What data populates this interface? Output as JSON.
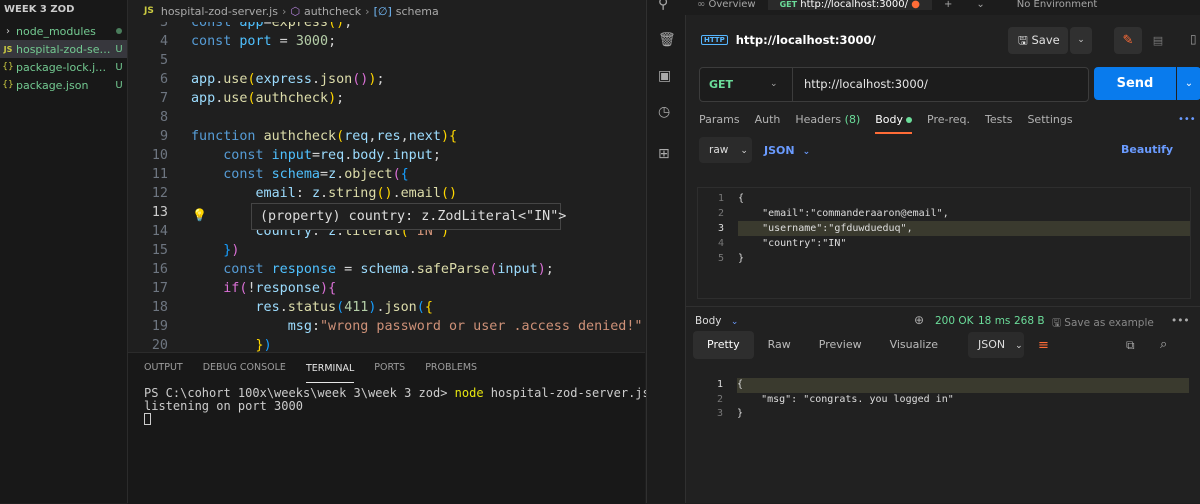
{
  "explorer": {
    "title": "WEEK 3 ZOD",
    "items": [
      {
        "icon": "›",
        "name": "node_modules",
        "badge": ""
      },
      {
        "icon": "JS",
        "name": "hospital-zod-server.js",
        "badge": "U"
      },
      {
        "icon": "{}",
        "name": "package-lock.json",
        "badge": "U"
      },
      {
        "icon": "{}",
        "name": "package.json",
        "badge": "U"
      }
    ]
  },
  "breadcrumb": {
    "file": "hospital-zod-server.js",
    "func": "authcheck",
    "var": "schema"
  },
  "tooltip_text": "(property) country: z.ZodLiteral<\"IN\">",
  "panel_tabs": [
    "OUTPUT",
    "DEBUG CONSOLE",
    "TERMINAL",
    "PORTS",
    "PROBLEMS"
  ],
  "terminal": {
    "prompt": "PS C:\\cohort 100x\\weeks\\week 3\\week 3 zod> ",
    "command": "node",
    "arg": " hospital-zod-server.js",
    "output": "listening on port 3000"
  },
  "postman": {
    "top_tabs": {
      "overview": "Overview",
      "method": "GET",
      "url": "http://localhost:3000/",
      "plus": "+",
      "env": "No Environment"
    },
    "http_badge": "HTTP",
    "title": "http://localhost:3000/",
    "save_label": "Save",
    "method": "GET",
    "url": "http://localhost:3000/",
    "send_label": "Send",
    "req_tabs": [
      "Params",
      "Auth",
      "Headers",
      "Body",
      "Pre-req.",
      "Tests",
      "Settings"
    ],
    "headers_count": "(8)",
    "more": "•••",
    "body_mode": "raw",
    "body_lang": "JSON",
    "beautify_label": "Beautify",
    "request_body": [
      "{",
      "    \"email\":\"commanderaaron@email\",",
      "    \"username\":\"gfduwdueduq\",",
      "    \"country\":\"IN\"",
      "}"
    ],
    "response": {
      "label": "Body",
      "status": "200 OK",
      "time": "18 ms",
      "size": "268 B",
      "save_example": "Save as example",
      "tabs": [
        "Pretty",
        "Raw",
        "Preview",
        "Visualize"
      ],
      "format": "JSON",
      "lines": [
        "{",
        "    \"msg\": \"congrats. you logged in\"",
        "}"
      ]
    }
  }
}
